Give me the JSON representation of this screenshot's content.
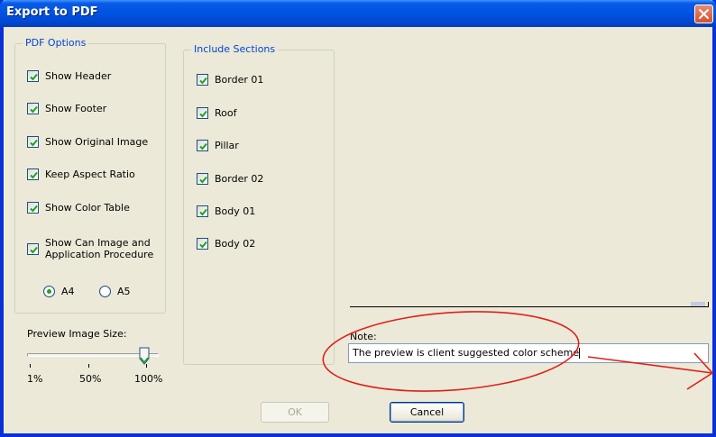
{
  "window": {
    "title": "Export to PDF"
  },
  "pdf_options": {
    "title": "PDF Options",
    "items": [
      {
        "label": "Show Header",
        "checked": true
      },
      {
        "label": "Show Footer",
        "checked": true
      },
      {
        "label": "Show Original Image",
        "checked": true
      },
      {
        "label": "Keep Aspect Ratio",
        "checked": true
      },
      {
        "label": "Show Color Table",
        "checked": true
      },
      {
        "label_line1": "Show Can Image and",
        "label_line2": "Application Procedure",
        "checked": true
      }
    ],
    "paper": [
      {
        "label": "A4",
        "selected": true
      },
      {
        "label": "A5",
        "selected": false
      }
    ]
  },
  "include_sections": {
    "title": "Include Sections",
    "items": [
      {
        "label": "Border 01",
        "checked": true
      },
      {
        "label": "Roof",
        "checked": true
      },
      {
        "label": "Pillar",
        "checked": true
      },
      {
        "label": "Border 02",
        "checked": true
      },
      {
        "label": "Body 01",
        "checked": true
      },
      {
        "label": "Body 02",
        "checked": true
      }
    ]
  },
  "preview_size": {
    "label": "Preview Image Size:",
    "ticks": [
      "1%",
      "50%",
      "100%"
    ],
    "value": 1.0
  },
  "note": {
    "label": "Note:",
    "value": "The preview is client suggested color scheme"
  },
  "buttons": {
    "ok": "OK",
    "cancel": "Cancel"
  },
  "colors": {
    "titlebar": "#0054e3",
    "group_title": "#0046d5",
    "annotation": "#e0201b"
  }
}
